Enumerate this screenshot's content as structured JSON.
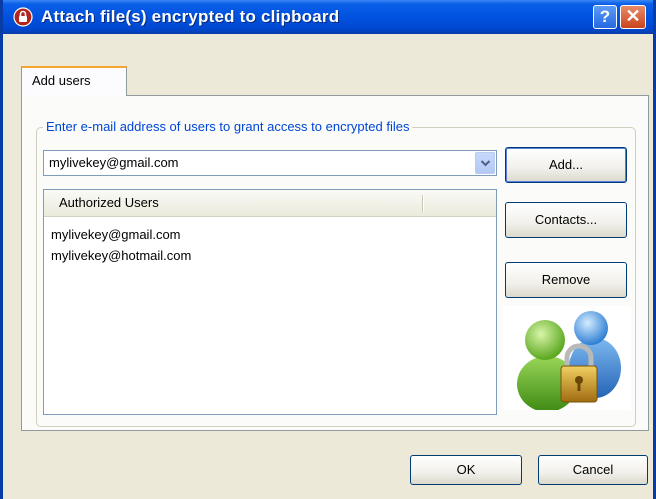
{
  "window": {
    "title": "Attach file(s) encrypted to clipboard",
    "help_label": "?",
    "close_label": "✕"
  },
  "tabs": [
    {
      "label": "Add users",
      "selected": true
    }
  ],
  "group": {
    "legend": "Enter e-mail address of users to grant access to encrypted files"
  },
  "email_combo": {
    "value": "mylivekey@gmail.com"
  },
  "authorized_users": {
    "header": "Authorized Users",
    "items": [
      "mylivekey@gmail.com",
      "mylivekey@hotmail.com"
    ]
  },
  "buttons": {
    "add": "Add...",
    "contacts": "Contacts...",
    "remove": "Remove",
    "ok": "OK",
    "cancel": "Cancel"
  },
  "colors": {
    "titlebar": "#0052df",
    "legend_text": "#0046d5",
    "window_bg": "#ece9d8"
  },
  "icons": {
    "title": "lock-app-icon",
    "dropdown": "chevron-down-icon",
    "illustration": "users-lock-icon"
  }
}
